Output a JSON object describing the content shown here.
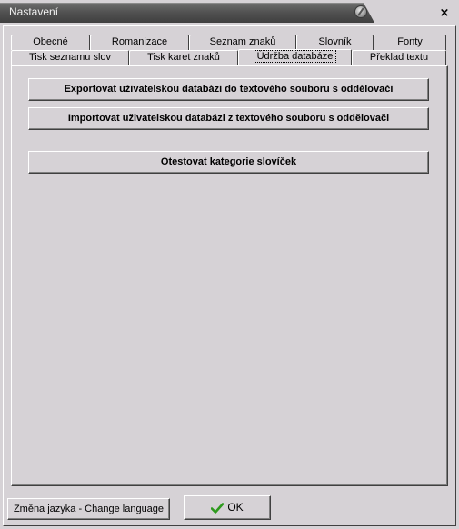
{
  "window": {
    "title": "Nastavení",
    "close_glyph": "×",
    "title_icon": "gear-settings-icon"
  },
  "tabs": {
    "row_back": [
      "Obecné",
      "Romanizace",
      "Seznam znaků",
      "Slovník",
      "Fonty"
    ],
    "row_front": [
      "Tisk seznamu slov",
      "Tisk karet znaků",
      "Údržba databáze",
      "Překlad textu"
    ],
    "active": "Údržba databáze"
  },
  "panel": {
    "export_button": "Exportovat uživatelskou databázi do textového souboru s oddělovači",
    "import_button": "Importovat uživatelskou databázi z textového souboru s oddělovači",
    "test_button": "Otestovat kategorie slovíček"
  },
  "footer": {
    "language_button": "Změna jazyka - Change language",
    "ok_button": "OK",
    "ok_icon": "checkmark-icon",
    "ok_icon_color": "#2e9a1e"
  },
  "colors": {
    "face": "#d6d2d6",
    "titlebar": "#525252",
    "highlight": "#ffffff",
    "shadow": "#404040"
  }
}
